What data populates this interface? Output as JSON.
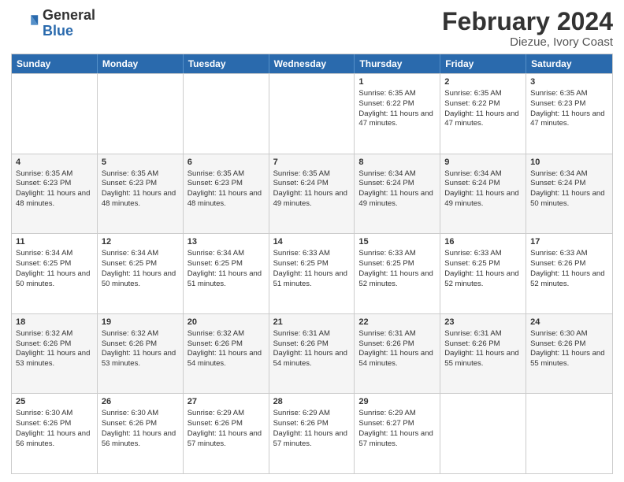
{
  "logo": {
    "general": "General",
    "blue": "Blue"
  },
  "title": {
    "month": "February 2024",
    "location": "Diezue, Ivory Coast"
  },
  "header_days": [
    "Sunday",
    "Monday",
    "Tuesday",
    "Wednesday",
    "Thursday",
    "Friday",
    "Saturday"
  ],
  "weeks": [
    [
      {
        "day": "",
        "info": ""
      },
      {
        "day": "",
        "info": ""
      },
      {
        "day": "",
        "info": ""
      },
      {
        "day": "",
        "info": ""
      },
      {
        "day": "1",
        "info": "Sunrise: 6:35 AM\nSunset: 6:22 PM\nDaylight: 11 hours and 47 minutes."
      },
      {
        "day": "2",
        "info": "Sunrise: 6:35 AM\nSunset: 6:22 PM\nDaylight: 11 hours and 47 minutes."
      },
      {
        "day": "3",
        "info": "Sunrise: 6:35 AM\nSunset: 6:23 PM\nDaylight: 11 hours and 47 minutes."
      }
    ],
    [
      {
        "day": "4",
        "info": "Sunrise: 6:35 AM\nSunset: 6:23 PM\nDaylight: 11 hours and 48 minutes."
      },
      {
        "day": "5",
        "info": "Sunrise: 6:35 AM\nSunset: 6:23 PM\nDaylight: 11 hours and 48 minutes."
      },
      {
        "day": "6",
        "info": "Sunrise: 6:35 AM\nSunset: 6:23 PM\nDaylight: 11 hours and 48 minutes."
      },
      {
        "day": "7",
        "info": "Sunrise: 6:35 AM\nSunset: 6:24 PM\nDaylight: 11 hours and 49 minutes."
      },
      {
        "day": "8",
        "info": "Sunrise: 6:34 AM\nSunset: 6:24 PM\nDaylight: 11 hours and 49 minutes."
      },
      {
        "day": "9",
        "info": "Sunrise: 6:34 AM\nSunset: 6:24 PM\nDaylight: 11 hours and 49 minutes."
      },
      {
        "day": "10",
        "info": "Sunrise: 6:34 AM\nSunset: 6:24 PM\nDaylight: 11 hours and 50 minutes."
      }
    ],
    [
      {
        "day": "11",
        "info": "Sunrise: 6:34 AM\nSunset: 6:25 PM\nDaylight: 11 hours and 50 minutes."
      },
      {
        "day": "12",
        "info": "Sunrise: 6:34 AM\nSunset: 6:25 PM\nDaylight: 11 hours and 50 minutes."
      },
      {
        "day": "13",
        "info": "Sunrise: 6:34 AM\nSunset: 6:25 PM\nDaylight: 11 hours and 51 minutes."
      },
      {
        "day": "14",
        "info": "Sunrise: 6:33 AM\nSunset: 6:25 PM\nDaylight: 11 hours and 51 minutes."
      },
      {
        "day": "15",
        "info": "Sunrise: 6:33 AM\nSunset: 6:25 PM\nDaylight: 11 hours and 52 minutes."
      },
      {
        "day": "16",
        "info": "Sunrise: 6:33 AM\nSunset: 6:25 PM\nDaylight: 11 hours and 52 minutes."
      },
      {
        "day": "17",
        "info": "Sunrise: 6:33 AM\nSunset: 6:26 PM\nDaylight: 11 hours and 52 minutes."
      }
    ],
    [
      {
        "day": "18",
        "info": "Sunrise: 6:32 AM\nSunset: 6:26 PM\nDaylight: 11 hours and 53 minutes."
      },
      {
        "day": "19",
        "info": "Sunrise: 6:32 AM\nSunset: 6:26 PM\nDaylight: 11 hours and 53 minutes."
      },
      {
        "day": "20",
        "info": "Sunrise: 6:32 AM\nSunset: 6:26 PM\nDaylight: 11 hours and 54 minutes."
      },
      {
        "day": "21",
        "info": "Sunrise: 6:31 AM\nSunset: 6:26 PM\nDaylight: 11 hours and 54 minutes."
      },
      {
        "day": "22",
        "info": "Sunrise: 6:31 AM\nSunset: 6:26 PM\nDaylight: 11 hours and 54 minutes."
      },
      {
        "day": "23",
        "info": "Sunrise: 6:31 AM\nSunset: 6:26 PM\nDaylight: 11 hours and 55 minutes."
      },
      {
        "day": "24",
        "info": "Sunrise: 6:30 AM\nSunset: 6:26 PM\nDaylight: 11 hours and 55 minutes."
      }
    ],
    [
      {
        "day": "25",
        "info": "Sunrise: 6:30 AM\nSunset: 6:26 PM\nDaylight: 11 hours and 56 minutes."
      },
      {
        "day": "26",
        "info": "Sunrise: 6:30 AM\nSunset: 6:26 PM\nDaylight: 11 hours and 56 minutes."
      },
      {
        "day": "27",
        "info": "Sunrise: 6:29 AM\nSunset: 6:26 PM\nDaylight: 11 hours and 57 minutes."
      },
      {
        "day": "28",
        "info": "Sunrise: 6:29 AM\nSunset: 6:26 PM\nDaylight: 11 hours and 57 minutes."
      },
      {
        "day": "29",
        "info": "Sunrise: 6:29 AM\nSunset: 6:27 PM\nDaylight: 11 hours and 57 minutes."
      },
      {
        "day": "",
        "info": ""
      },
      {
        "day": "",
        "info": ""
      }
    ]
  ]
}
